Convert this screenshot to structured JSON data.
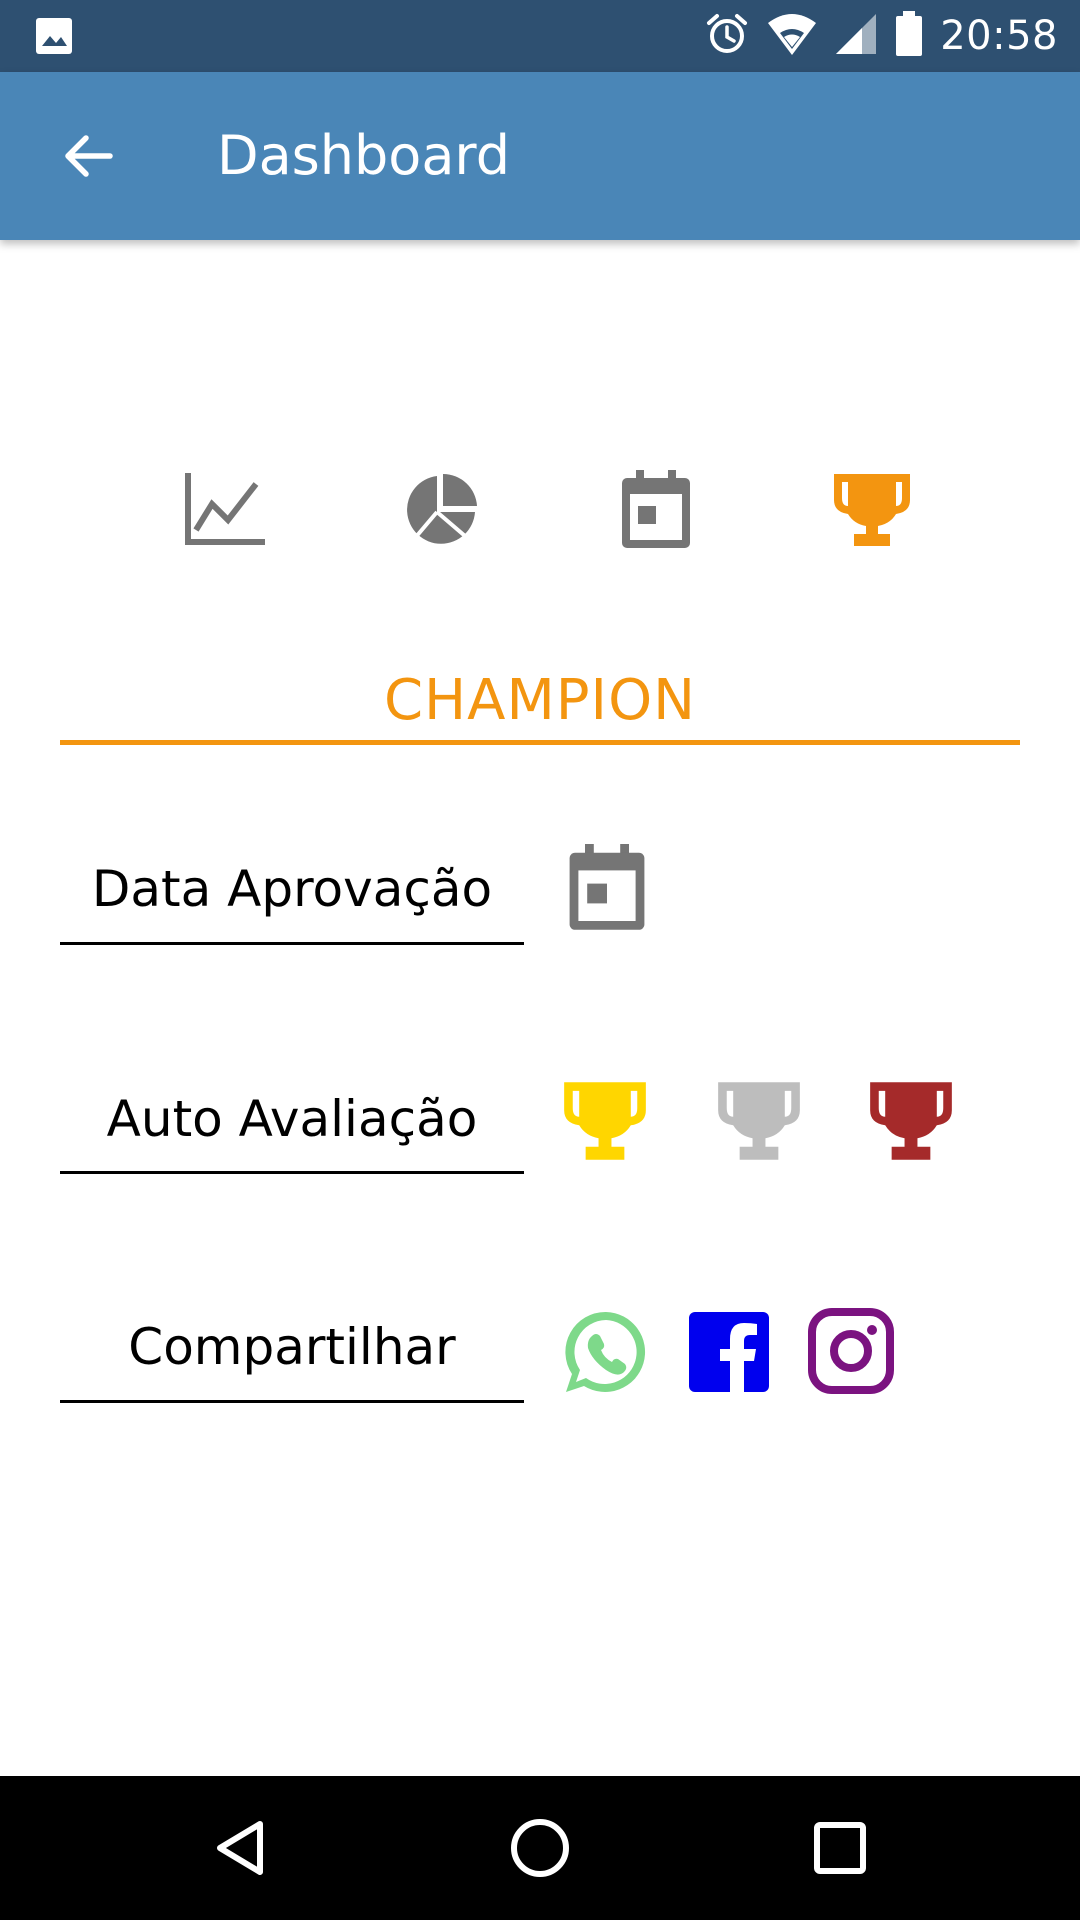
{
  "status_bar": {
    "time": "20:58",
    "icons": [
      "image-icon",
      "alarm-icon",
      "wifi-icon",
      "cell-signal-icon",
      "battery-icon"
    ]
  },
  "app_bar": {
    "title": "Dashboard",
    "back_icon": "arrow-back-icon"
  },
  "tabs": [
    {
      "icon": "line-chart-icon",
      "color": "#757575",
      "selected": false
    },
    {
      "icon": "pie-chart-icon",
      "color": "#757575",
      "selected": false
    },
    {
      "icon": "calendar-icon",
      "color": "#757575",
      "selected": false
    },
    {
      "icon": "trophy-icon",
      "color": "#f39510",
      "selected": true
    }
  ],
  "section": {
    "title": "CHAMPION",
    "accent_color": "#f39510"
  },
  "rows": {
    "approval_date": {
      "label": "Data Aprovação",
      "icon": "calendar-icon"
    },
    "self_assessment": {
      "label": "Auto Avaliação",
      "trophies": [
        {
          "name": "gold",
          "color": "#ffd600"
        },
        {
          "name": "silver",
          "color": "#bdbdbd"
        },
        {
          "name": "bronze",
          "color": "#a52a2a"
        }
      ]
    },
    "share": {
      "label": "Compartilhar",
      "apps": [
        {
          "icon": "whatsapp-icon",
          "color": "#7ed98a"
        },
        {
          "icon": "facebook-icon",
          "color": "#0000ee"
        },
        {
          "icon": "instagram-icon",
          "color": "#7b1380"
        }
      ]
    }
  },
  "nav_bar": {
    "icons": [
      "back-triangle-icon",
      "home-circle-icon",
      "recents-square-icon"
    ]
  }
}
